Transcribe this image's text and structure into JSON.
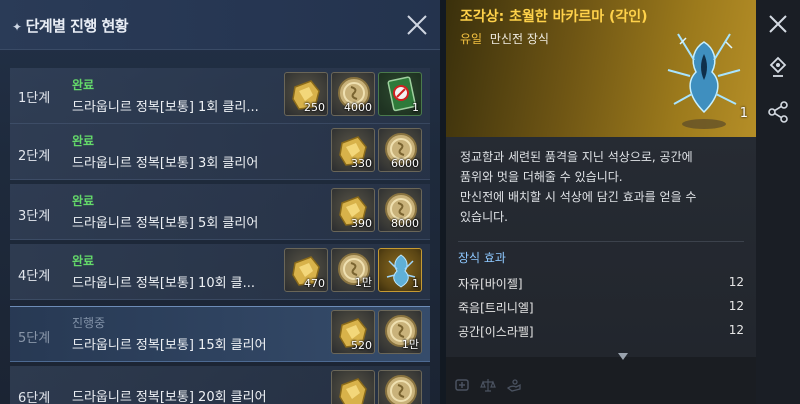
{
  "left_panel": {
    "title": "단계별 진행 현황",
    "close_icon": "close-icon",
    "stages": [
      {
        "label": "1단계",
        "status": "완료",
        "desc": "드라웁니르 정복[보통] 1회 클리...",
        "rewards": [
          {
            "icon": "gold-ore-icon",
            "qty": "250"
          },
          {
            "icon": "silver-coin-icon",
            "qty": "4000"
          },
          {
            "icon": "green-ticket-icon",
            "qty": "1"
          }
        ]
      },
      {
        "label": "2단계",
        "status": "완료",
        "desc": "드라웁니르 정복[보통] 3회 클리어",
        "rewards": [
          {
            "icon": "gold-ore-icon",
            "qty": "330"
          },
          {
            "icon": "silver-coin-icon",
            "qty": "6000"
          }
        ]
      },
      {
        "label": "3단계",
        "status": "완료",
        "desc": "드라웁니르 정복[보통] 5회 클리어",
        "rewards": [
          {
            "icon": "gold-ore-icon",
            "qty": "390"
          },
          {
            "icon": "silver-coin-icon",
            "qty": "8000"
          }
        ]
      },
      {
        "label": "4단계",
        "status": "완료",
        "desc": "드라웁니르 정복[보통] 10회 클...",
        "rewards": [
          {
            "icon": "gold-ore-icon",
            "qty": "470"
          },
          {
            "icon": "silver-coin-icon",
            "qty": "1만"
          },
          {
            "icon": "statue-icon",
            "qty": "1"
          }
        ]
      },
      {
        "label": "5단계",
        "status": "진행중",
        "desc": "드라웁니르 정복[보통] 15회 클리어",
        "rewards": [
          {
            "icon": "gold-ore-icon",
            "qty": "520"
          },
          {
            "icon": "silver-coin-icon",
            "qty": "1만"
          }
        ]
      },
      {
        "label": "6단계",
        "status": "",
        "desc": "드라웁니르 정복[보통] 20회 클리어",
        "rewards": [
          {
            "icon": "gold-ore-icon",
            "qty": ""
          },
          {
            "icon": "silver-coin-icon",
            "qty": ""
          }
        ]
      }
    ]
  },
  "right_panel": {
    "title": "조각상: 초월한 바카르마 (각인)",
    "grade": "유일",
    "category": "만신전 장식",
    "item_count": "1",
    "description": [
      "정교함과 세련된 품격을 지닌 석상으로, 공간에",
      "품위와 멋을 더해줄 수 있습니다.",
      "만신전에 배치할 시 석상에 담긴 효과를 얻을 수",
      "있습니다."
    ],
    "effect_title": "장식 효과",
    "effects": [
      {
        "name": "자유[바이젤]",
        "value": "12"
      },
      {
        "name": "죽음[트리니엘]",
        "value": "12"
      },
      {
        "name": "공간[이스라펠]",
        "value": "12"
      }
    ]
  },
  "side_toolbar": {
    "buttons": [
      "close-icon",
      "location-pin-icon",
      "share-icon"
    ]
  },
  "colors": {
    "complete_green": "#64d96a",
    "in_progress_gray": "#8292a8",
    "title_gold": "#ffd24a",
    "grade_gold": "#f2c040",
    "effect_blue": "#8ec8ff"
  }
}
